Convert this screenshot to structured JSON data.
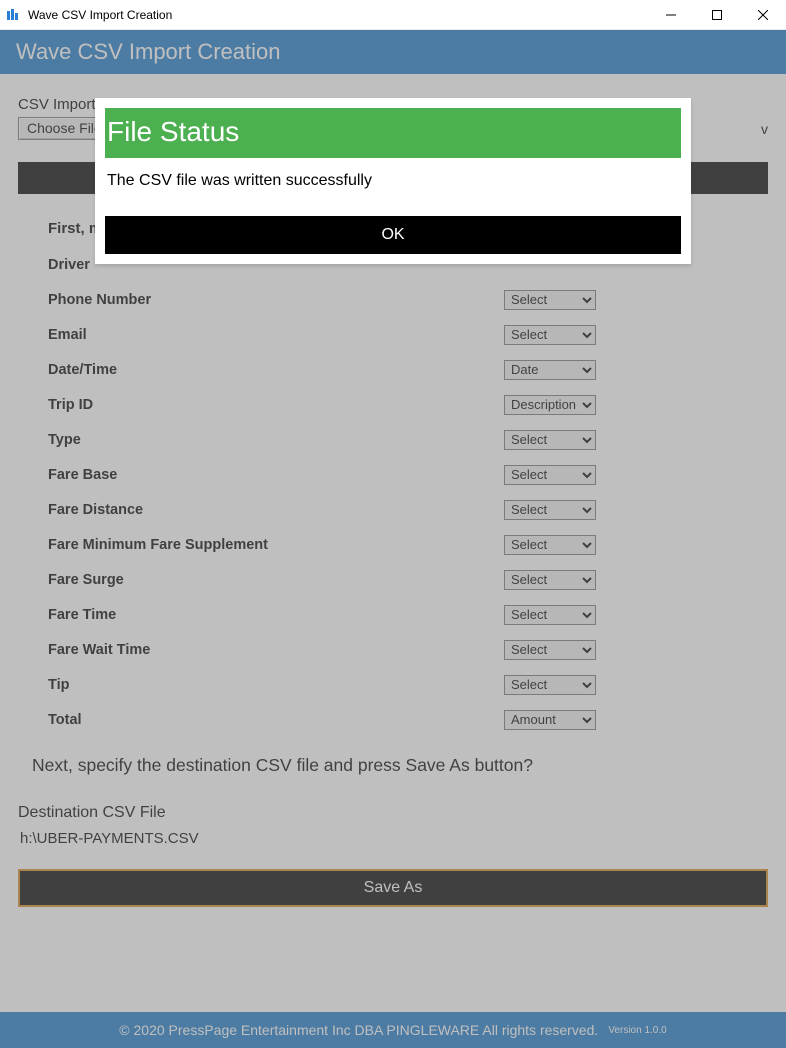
{
  "window": {
    "title": "Wave CSV Import Creation"
  },
  "header": {
    "title": "Wave CSV Import Creation"
  },
  "csv_import": {
    "label": "CSV Import",
    "choose_button": "Choose File",
    "file_tail": "v"
  },
  "instruction_first": "First, map the Uber CSV columns to Wave CSV columns?",
  "form": {
    "rows": [
      {
        "label": "Driver",
        "value": ""
      },
      {
        "label": "Phone Number",
        "value": "Select"
      },
      {
        "label": "Email",
        "value": "Select"
      },
      {
        "label": "Date/Time",
        "value": "Date"
      },
      {
        "label": "Trip ID",
        "value": "Description"
      },
      {
        "label": "Type",
        "value": "Select"
      },
      {
        "label": "Fare Base",
        "value": "Select"
      },
      {
        "label": "Fare Distance",
        "value": "Select"
      },
      {
        "label": "Fare Minimum Fare Supplement",
        "value": "Select"
      },
      {
        "label": "Fare Surge",
        "value": "Select"
      },
      {
        "label": "Fare Time",
        "value": "Select"
      },
      {
        "label": "Fare Wait Time",
        "value": "Select"
      },
      {
        "label": "Tip",
        "value": "Select"
      },
      {
        "label": "Total",
        "value": "Amount"
      }
    ]
  },
  "instruction_next": "Next, specify the destination CSV file and press Save As button?",
  "destination": {
    "label": "Destination CSV File",
    "value": "h:\\UBER-PAYMENTS.CSV"
  },
  "save_as": "Save As",
  "footer": {
    "copyright": "© 2020 PressPage Entertainment Inc DBA PINGLEWARE  All rights reserved.",
    "version": "Version 1.0.0"
  },
  "modal": {
    "title": "File Status",
    "message": "The CSV file was written successfully",
    "ok": "OK"
  }
}
